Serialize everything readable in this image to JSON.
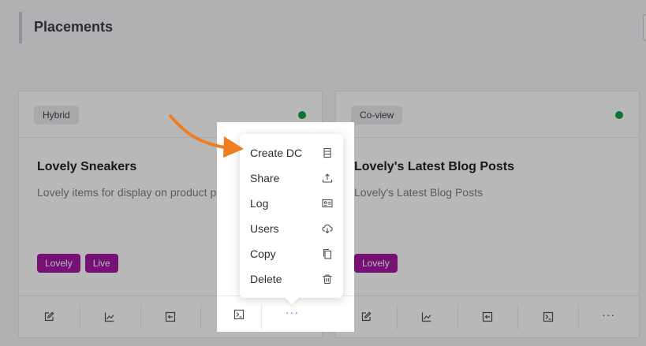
{
  "page": {
    "title": "Placements"
  },
  "cards": [
    {
      "type": "Hybrid",
      "status_color": "#15a04a",
      "title": "Lovely Sneakers",
      "description": "Lovely items for display on product pages",
      "tags": [
        "Lovely",
        "Live"
      ]
    },
    {
      "type": "Co-view",
      "status_color": "#15a04a",
      "title": "Lovely's Latest Blog Posts",
      "description": "Lovely's Latest Blog Posts",
      "tags": [
        "Lovely"
      ]
    }
  ],
  "card_actions": [
    "edit-icon",
    "chart-icon",
    "embed-icon",
    "code-icon",
    "more-icon"
  ],
  "more_label": "···",
  "menu": {
    "items": [
      {
        "label": "Create DC",
        "icon": "list-icon"
      },
      {
        "label": "Share",
        "icon": "upload-icon"
      },
      {
        "label": "Log",
        "icon": "id-card-icon"
      },
      {
        "label": "Users",
        "icon": "cloud-download-icon"
      },
      {
        "label": "Copy",
        "icon": "copy-icon"
      },
      {
        "label": "Delete",
        "icon": "trash-icon"
      }
    ]
  },
  "colors": {
    "tag": "#a41aa4",
    "status": "#15a04a",
    "arrow": "#ee7e22",
    "more_active": "#3b82f6"
  }
}
